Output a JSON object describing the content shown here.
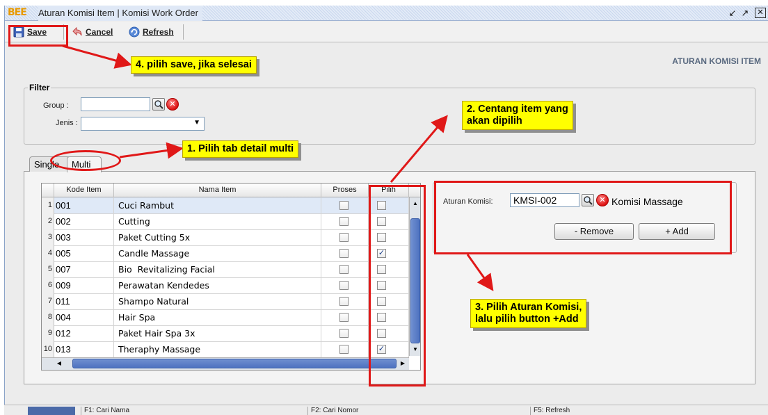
{
  "window": {
    "logo": "BEE",
    "title": "Aturan Komisi Item | Komisi Work Order",
    "controls": [
      "restore-icon",
      "maximize-icon",
      "close-icon"
    ]
  },
  "toolbar": {
    "save_label": "Save",
    "cancel_label": "Cancel",
    "refresh_label": "Refresh"
  },
  "page_heading": "ATURAN KOMISI ITEM",
  "filter": {
    "legend": "Filter",
    "group_label": "Group :",
    "group_value": "",
    "jenis_label": "Jenis :",
    "jenis_value": ""
  },
  "tabs": [
    {
      "label": "Single",
      "active": false
    },
    {
      "label": "Multi",
      "active": true
    }
  ],
  "grid": {
    "columns": [
      "Kode Item",
      "Nama Item",
      "Proses",
      "Pilih"
    ],
    "rows": [
      {
        "no": "1",
        "kode": "001",
        "nama": "Cuci Rambut",
        "proses": false,
        "pilih": false
      },
      {
        "no": "2",
        "kode": "002",
        "nama": "Cutting",
        "proses": false,
        "pilih": false
      },
      {
        "no": "3",
        "kode": "003",
        "nama": "Paket Cutting 5x",
        "proses": false,
        "pilih": false
      },
      {
        "no": "4",
        "kode": "005",
        "nama": "Candle Massage",
        "proses": false,
        "pilih": true
      },
      {
        "no": "5",
        "kode": "007",
        "nama": "Bio  Revitalizing Facial",
        "proses": false,
        "pilih": false
      },
      {
        "no": "6",
        "kode": "009",
        "nama": "Perawatan Kendedes",
        "proses": false,
        "pilih": false
      },
      {
        "no": "7",
        "kode": "011",
        "nama": "Shampo Natural",
        "proses": false,
        "pilih": false
      },
      {
        "no": "8",
        "kode": "004",
        "nama": "Hair Spa",
        "proses": false,
        "pilih": false
      },
      {
        "no": "9",
        "kode": "012",
        "nama": "Paket Hair Spa 3x",
        "proses": false,
        "pilih": false
      },
      {
        "no": "10",
        "kode": "013",
        "nama": "Theraphy Massage",
        "proses": false,
        "pilih": true
      }
    ]
  },
  "komisi": {
    "label": "Aturan Komisi:",
    "code": "KMSI-002",
    "name": "Komisi Massage",
    "remove_label": "- Remove",
    "add_label": "+ Add"
  },
  "statusbar": {
    "f1": "F1: Cari Nama",
    "f2": "F2: Cari Nomor",
    "f5": "F5: Refresh"
  },
  "annotations": {
    "step1": "1. Pilih tab detail multi",
    "step2_line1": "2. Centang item yang",
    "step2_line2": "akan dipilih",
    "step3_line1": "3. Pilih Aturan Komisi,",
    "step3_line2": "lalu pilih button +Add",
    "step4": "4. pilih save, jika selesai",
    "highlight_color": "#ffff00",
    "arrow_color": "#e01818"
  }
}
